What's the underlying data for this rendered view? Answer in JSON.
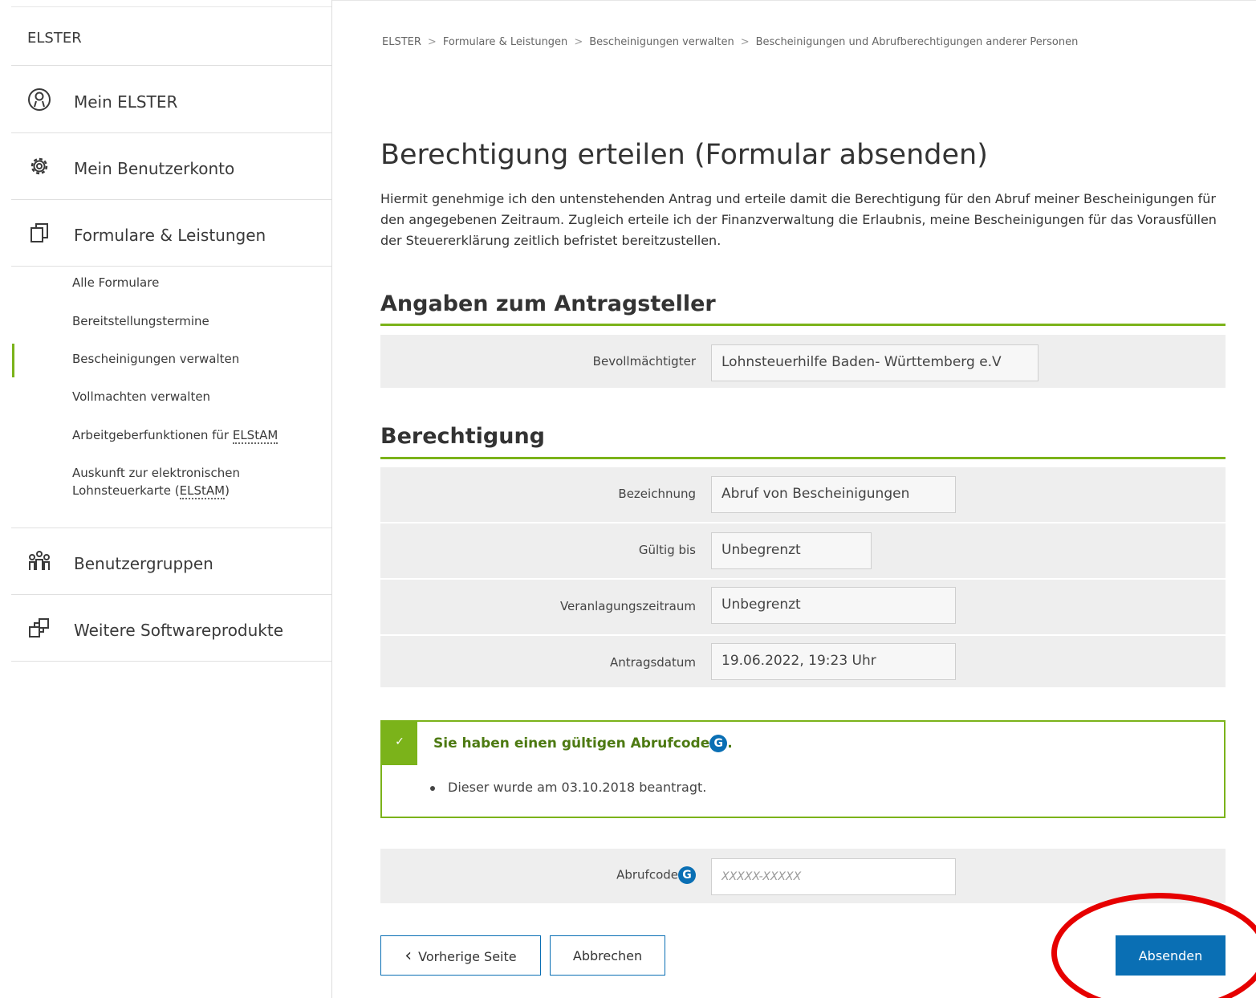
{
  "sidebar": {
    "brand": "ELSTER",
    "main_items": [
      {
        "label": "Mein ELSTER",
        "icon": "user-circle-icon"
      },
      {
        "label": "Mein Benutzerkonto",
        "icon": "gear-icon"
      },
      {
        "label": "Formulare & Leistungen",
        "icon": "documents-icon"
      },
      {
        "label": "Benutzergruppen",
        "icon": "user-group-icon"
      },
      {
        "label": "Weitere Softwareprodukte",
        "icon": "software-products-icon"
      }
    ],
    "sub_items": {
      "alle_formulare": "Alle Formulare",
      "bereitstellungstermine": "Bereitstellungstermine",
      "bescheinigungen_verwalten": "Bescheinigungen verwalten",
      "vollmachten_verwalten": "Vollmachten verwalten",
      "arbeitgeber_prefix": "Arbeitgeberfunktionen für ",
      "arbeitgeber_abbr": "ELStAM",
      "auskunft_line1": "Auskunft zur elektronischen",
      "auskunft_line2_prefix": "Lohnsteuerkarte (",
      "auskunft_line2_abbr": "ELStAM",
      "auskunft_line2_suffix": ")"
    }
  },
  "breadcrumb": {
    "items": [
      "ELSTER",
      "Formulare & Leistungen",
      "Bescheinigungen verwalten",
      "Bescheinigungen und Abrufberechtigungen anderer Personen"
    ],
    "separator": ">"
  },
  "page": {
    "title": "Berechtigung erteilen (Formular absenden)",
    "intro": "Hiermit genehmige ich den untenstehenden Antrag und erteile damit die Berechtigung für den Abruf meiner Bescheinigungen für den angegebenen Zeitraum. Zugleich erteile ich der Finanzverwaltung die Erlaubnis, meine Bescheinigungen für das Vorausfüllen der Steuererklärung zeitlich befristet bereitzustellen."
  },
  "antragsteller": {
    "heading": "Angaben zum Antragsteller",
    "bevollmaechtigter_label": "Bevollmächtigter",
    "bevollmaechtigter_value": "Lohnsteuerhilfe Baden- Württemberg e.V"
  },
  "berechtigung": {
    "heading": "Berechtigung",
    "rows": [
      {
        "label": "Bezeichnung",
        "value": "Abruf von Bescheinigungen"
      },
      {
        "label": "Gültig bis",
        "value": "Unbegrenzt"
      },
      {
        "label": "Veranlagungszeitraum",
        "value": "Unbegrenzt"
      },
      {
        "label": "Antragsdatum",
        "value": "19.06.2022, 19:23 Uhr"
      }
    ]
  },
  "notice": {
    "check": "✓",
    "title": "Sie haben einen gültigen Abrufcode",
    "badge": "G",
    "title_suffix": ".",
    "item": "Dieser wurde am 03.10.2018 beantragt."
  },
  "abrufcode": {
    "label": "Abrufcode",
    "badge": "G",
    "placeholder": "XXXXX-XXXXX"
  },
  "buttons": {
    "previous": "Vorherige Seite",
    "previous_icon": "‹",
    "cancel": "Abbrechen",
    "submit": "Absenden"
  },
  "colors": {
    "accent_green": "#7bb31a",
    "primary_blue": "#0a6fb4",
    "highlight_red": "#e60000"
  }
}
